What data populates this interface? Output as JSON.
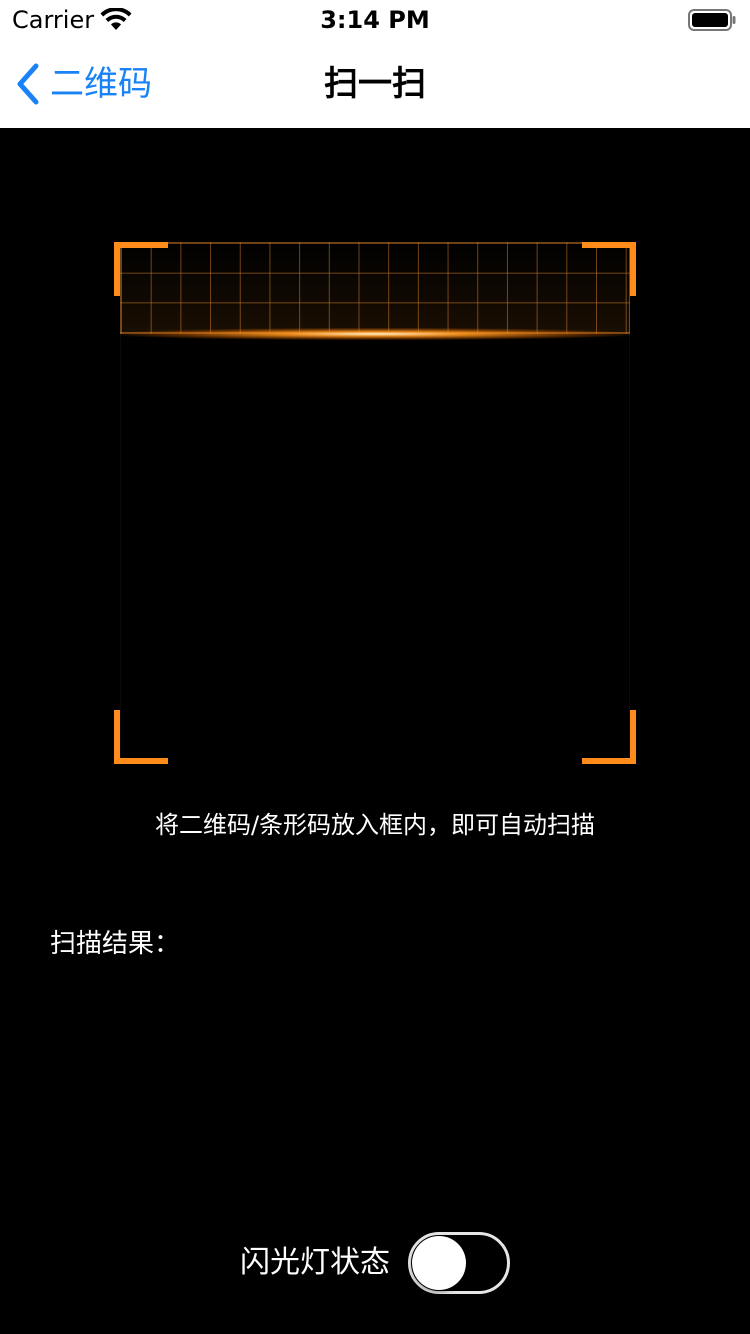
{
  "status_bar": {
    "carrier": "Carrier",
    "time": "3:14 PM",
    "wifi_icon": "wifi-icon",
    "battery_icon": "battery-icon"
  },
  "nav_bar": {
    "back_label": "二维码",
    "title": "扫一扫",
    "back_color": "#1a82f7"
  },
  "scanner": {
    "accent_color": "#ff8c1a",
    "hint": "将二维码/条形码放入框内，即可自动扫描"
  },
  "result": {
    "label": "扫描结果："
  },
  "flash": {
    "label": "闪光灯状态",
    "enabled": false
  }
}
